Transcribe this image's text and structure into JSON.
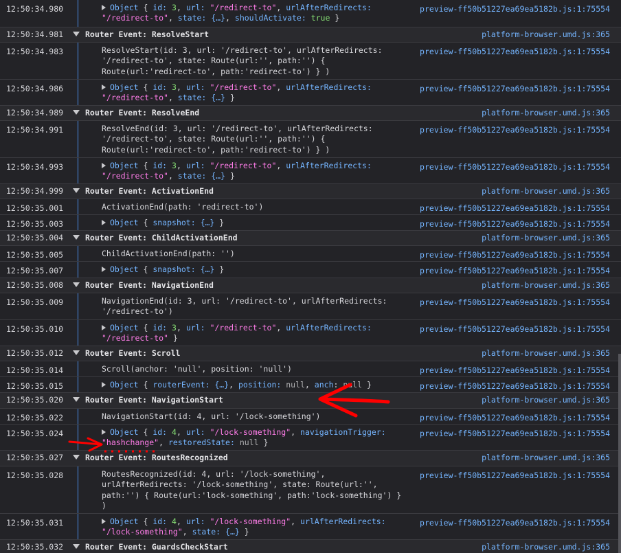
{
  "sources": {
    "preview": "preview-ff50b51227ea69ea5182b.js:1:75554",
    "platform": "platform-browser.umd.js:365"
  },
  "rows": [
    {
      "ts": "12:50:34.980",
      "lines": [
        [
          "  "
        ],
        [
          "Object { "
        ],
        [
          "id: "
        ],
        [
          "3"
        ],
        [
          ", url: "
        ],
        [
          "\"/redirect-to\""
        ],
        [
          ", urlAfterRedirects:"
        ]
      ]
    },
    {
      "ts": "12:50:34.981",
      "title": "Router Event: ResolveStart"
    },
    {
      "ts": "12:50:34.983"
    },
    {
      "ts": "12:50:34.986"
    },
    {
      "ts": "12:50:34.989",
      "title": "Router Event: ResolveEnd"
    },
    {
      "ts": "12:50:34.991"
    },
    {
      "ts": "12:50:34.993"
    },
    {
      "ts": "12:50:34.999",
      "title": "Router Event: ActivationEnd"
    },
    {
      "ts": "12:50:35.001"
    },
    {
      "ts": "12:50:35.003"
    },
    {
      "ts": "12:50:35.004",
      "title": "Router Event: ChildActivationEnd"
    },
    {
      "ts": "12:50:35.005"
    },
    {
      "ts": "12:50:35.007"
    },
    {
      "ts": "12:50:35.008",
      "title": "Router Event: NavigationEnd"
    },
    {
      "ts": "12:50:35.009"
    },
    {
      "ts": "12:50:35.010"
    },
    {
      "ts": "12:50:35.012",
      "title": "Router Event: Scroll"
    },
    {
      "ts": "12:50:35.014"
    },
    {
      "ts": "12:50:35.015"
    },
    {
      "ts": "12:50:35.020",
      "title": "Router Event: NavigationStart"
    },
    {
      "ts": "12:50:35.022"
    },
    {
      "ts": "12:50:35.024"
    },
    {
      "ts": "12:50:35.027",
      "title": "Router Event: RoutesRecognized"
    },
    {
      "ts": "12:50:35.028"
    },
    {
      "ts": "12:50:35.031"
    },
    {
      "ts": "12:50:35.032",
      "title": "Router Event: GuardsCheckStart"
    }
  ],
  "messages": {
    "m0a": "\"/redirect-to\"",
    "m0b": ", state: {…}, ",
    "m0c": "shouldActivate: ",
    "m0d": "true",
    "m0e": " }",
    "resolveStart_text": "ResolveStart(id: 3, url: '/redirect-to', urlAfterRedirects:\n'/redirect-to', state: Route(url:'', path:'') {\nRoute(url:'redirect-to', path:'redirect-to') } )",
    "resolveEnd_text": "ResolveEnd(id: 3, url: '/redirect-to', urlAfterRedirects:\n'/redirect-to', state: Route(url:'', path:'') {\nRoute(url:'redirect-to', path:'redirect-to') } )",
    "activationEnd_text": "ActivationEnd(path: 'redirect-to')",
    "childActivationEnd_text": "ChildActivationEnd(path: '')",
    "navigationEnd_text": "NavigationEnd(id: 3, url: '/redirect-to', urlAfterRedirects:\n'/redirect-to')",
    "scroll_text": "Scroll(anchor: 'null', position: 'null')",
    "navigationStart_text": "NavigationStart(id: 4, url: '/lock-something')",
    "routesRecognized_text": "RoutesRecognized(id: 4, url: '/lock-something',\nurlAfterRedirects: '/lock-something', state: Route(url:'',\npath:'') { Route(url:'lock-something', path:'lock-something') }\n)"
  },
  "tokens": {
    "object": "Object",
    "id_key": "id: ",
    "url_key": "url: ",
    "uar_key": "urlAfterRedirects:",
    "state_key": "state: ",
    "obj_ellipsis": "{…}",
    "snapshot_key": "snapshot: ",
    "routerEvent_key": "routerEvent: ",
    "position_key": "position: ",
    "anchor_key_visible": "anch",
    "anchor_rest": ": ",
    "null": "null",
    "navigationTrigger_key": "navigationTrigger:",
    "restoredState_key": "restoredState: ",
    "id3": "3",
    "id4": "4",
    "redirect_to": "\"/redirect-to\"",
    "lock_something": "\"/lock-something\"",
    "hashchange": "\"hashchange\"",
    "open_brace": "{ ",
    "close_brace": " }",
    "comma": ", "
  },
  "colors": {
    "background": "#232327",
    "groupRow": "#2a2a2e",
    "link": "#75b5ff",
    "string": "#ff7de9",
    "number": "#86de74",
    "annotation": "#ff0000"
  }
}
